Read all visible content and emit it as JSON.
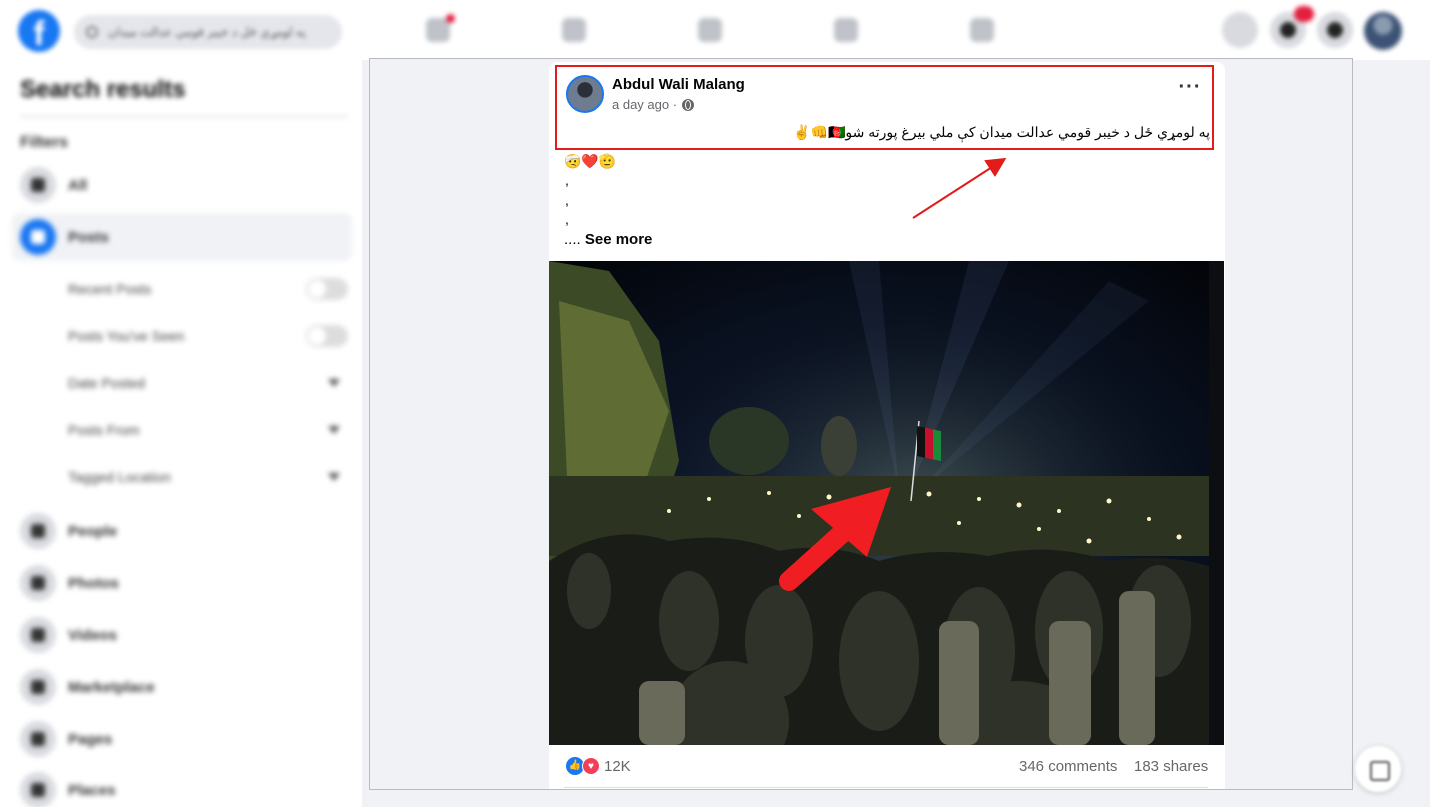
{
  "topnav": {
    "search_placeholder": "په لومړي ځل د خیبر قومي عدالت میدان"
  },
  "sidebar": {
    "title": "Search results",
    "filters_label": "Filters",
    "items": [
      {
        "label": "All",
        "icon": "all-icon"
      },
      {
        "label": "Posts",
        "icon": "posts-icon",
        "active": true
      },
      {
        "label": "People",
        "icon": "people-icon"
      },
      {
        "label": "Photos",
        "icon": "photos-icon"
      },
      {
        "label": "Videos",
        "icon": "videos-icon"
      },
      {
        "label": "Marketplace",
        "icon": "marketplace-icon"
      },
      {
        "label": "Pages",
        "icon": "pages-icon"
      },
      {
        "label": "Places",
        "icon": "places-icon"
      }
    ],
    "post_filters": [
      {
        "label": "Recent Posts",
        "control": "toggle"
      },
      {
        "label": "Posts You've Seen",
        "control": "toggle"
      },
      {
        "label": "Date Posted",
        "control": "dropdown"
      },
      {
        "label": "Posts From",
        "control": "dropdown"
      },
      {
        "label": "Tagged Location",
        "control": "dropdown"
      }
    ]
  },
  "post": {
    "author": "Abdul Wali Malang",
    "time": "a day ago ·",
    "text": "په لومړي ځل د خیبر قومي عدالت میدان کې ملي بیرغ پورته شو🇦🇫👊✌️",
    "emoji_line": "🤕❤️🫡",
    "comma_lines": [
      ",",
      ",",
      ","
    ],
    "ellipsis": "....",
    "see_more": "See more",
    "reaction_count": "12K",
    "comments": "346 comments",
    "shares": "183 shares"
  },
  "colors": {
    "facebook_blue": "#1877f2",
    "annotation_red": "#e21b1b",
    "notification_red": "#e41e3f",
    "love_red": "#f33e58"
  }
}
